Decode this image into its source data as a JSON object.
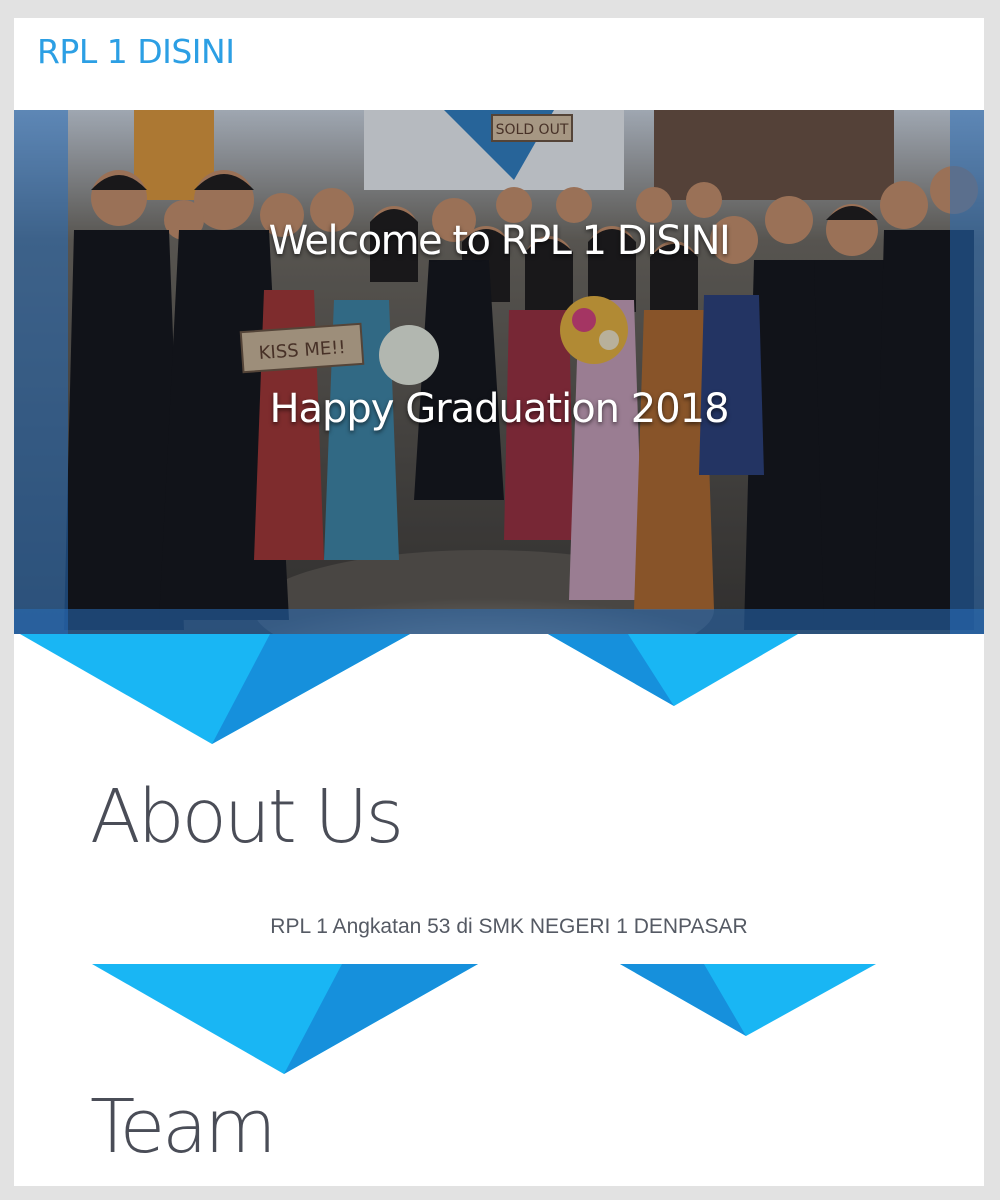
{
  "navbar": {
    "brand": "RPL 1 DISINI"
  },
  "hero": {
    "title": "Welcome to RPL 1 DISINI",
    "subtitle": "Happy Graduation 2018",
    "sign_left": "KISS ME!!",
    "sign_top": "SOLD OUT"
  },
  "about": {
    "heading": "About Us",
    "text": "RPL 1 Angkatan 53 di SMK NEGERI 1 DENPASAR"
  },
  "team": {
    "heading": "Team"
  },
  "colors": {
    "brand": "#2c9fe4",
    "accent_light": "#19b6f4",
    "accent_dark": "#1690dc",
    "heading": "#4a4d57",
    "hero_overlay": "#286eb9"
  }
}
